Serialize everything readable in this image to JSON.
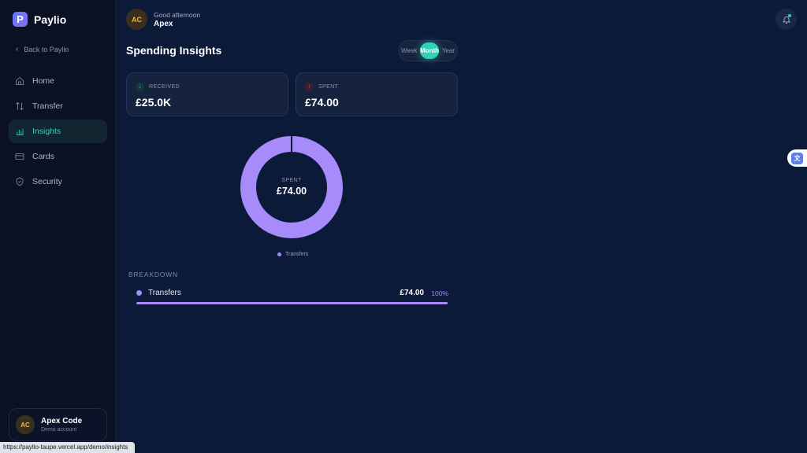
{
  "brand": {
    "logo_letter": "P",
    "name": "Paylio"
  },
  "sidebar": {
    "back_label": "Back to Paylio",
    "items": [
      {
        "label": "Home",
        "icon": "home-icon",
        "active": false
      },
      {
        "label": "Transfer",
        "icon": "transfer-icon",
        "active": false
      },
      {
        "label": "Insights",
        "icon": "insights-icon",
        "active": true
      },
      {
        "label": "Cards",
        "icon": "card-icon",
        "active": false
      },
      {
        "label": "Security",
        "icon": "shield-icon",
        "active": false
      }
    ],
    "user": {
      "initials": "AC",
      "name": "Apex Code",
      "subtitle": "Demo account"
    }
  },
  "header": {
    "initials": "AC",
    "greeting": "Good afternoon",
    "name": "Apex"
  },
  "page_title": "Spending Insights",
  "period": {
    "options": [
      "Week",
      "Month",
      "Year"
    ],
    "selected": "Month"
  },
  "stats": {
    "received": {
      "label": "RECEIVED",
      "value": "£25.0K"
    },
    "spent": {
      "label": "SPENT",
      "value": "£74.00"
    }
  },
  "chart_data": {
    "type": "pie",
    "center_label": "SPENT",
    "center_value": "£74.00",
    "categories": [
      "Transfers"
    ],
    "values": [
      74.0
    ],
    "colors": [
      "#a78bfa"
    ],
    "legend": [
      "Transfers"
    ]
  },
  "breakdown": {
    "title": "BREAKDOWN",
    "rows": [
      {
        "label": "Transfers",
        "amount": "£74.00",
        "percent": "100%",
        "fraction": 1.0
      }
    ]
  },
  "status_url": "https://paylio-taupe.vercel.app/demo/insights",
  "colors": {
    "accent": "#2ed3b7",
    "chart": "#a78bfa",
    "background": "#0c1a3a",
    "sidebar": "#0a1124"
  }
}
